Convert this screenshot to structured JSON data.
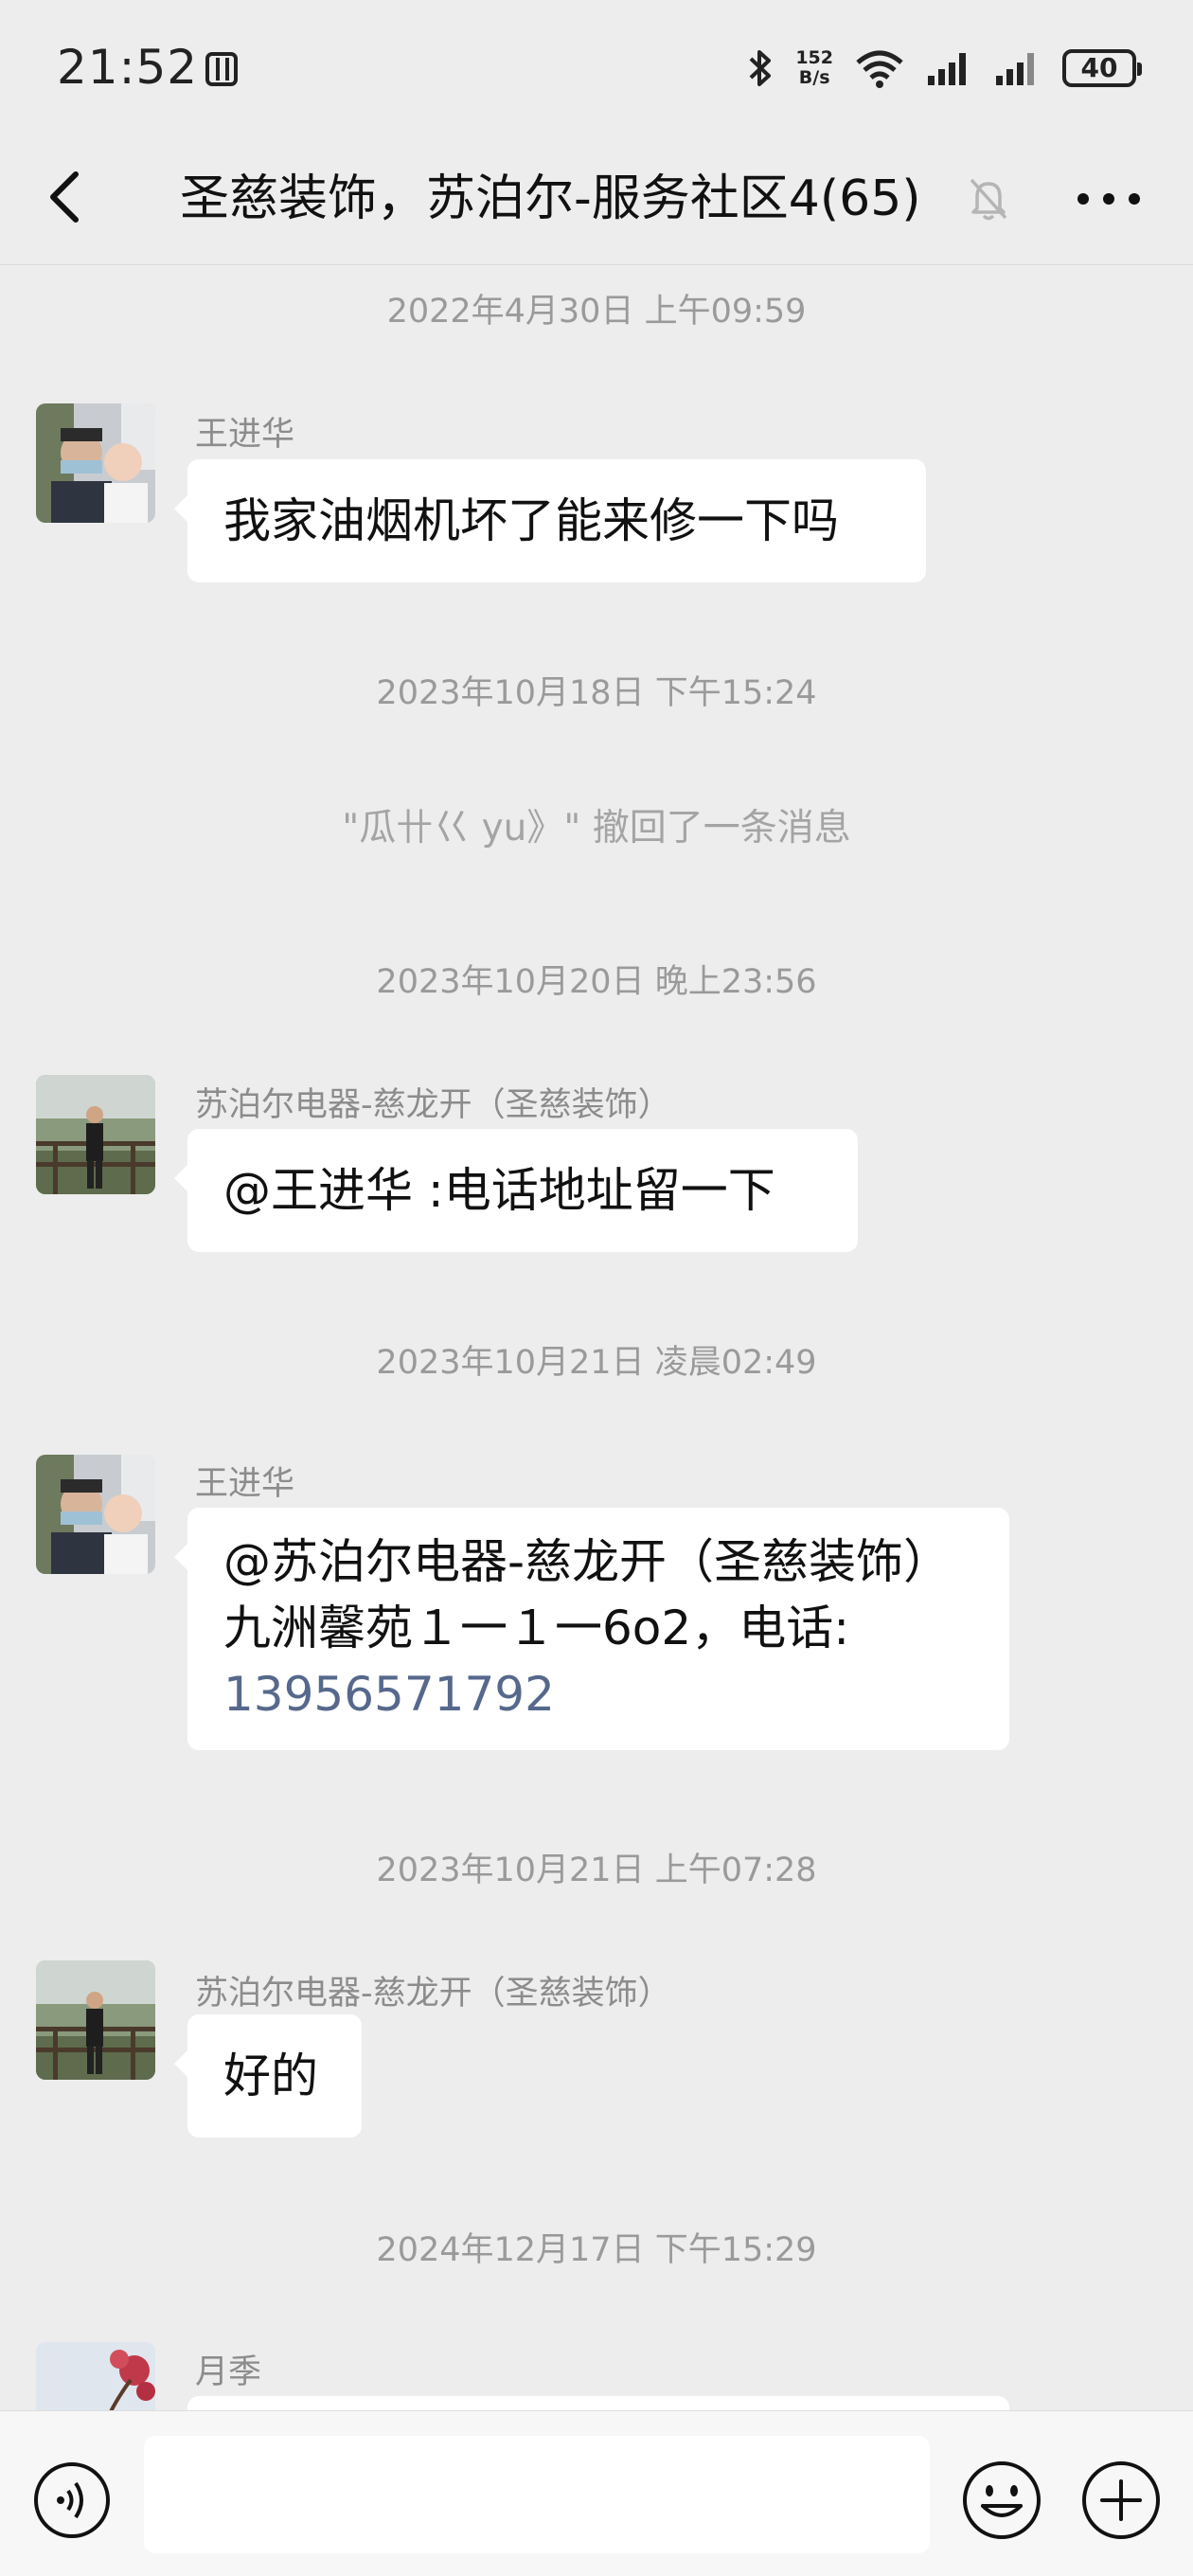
{
  "status_bar": {
    "time": "21:52",
    "net_speed_value": "152",
    "net_speed_unit": "B/s",
    "battery": "40"
  },
  "header": {
    "title": "圣慈装饰，苏泊尔-服务社区4(65)"
  },
  "messages": [
    {
      "type": "time",
      "text": "2022年4月30日 上午09:59"
    },
    {
      "type": "msg",
      "sender": "王进华",
      "lines": [
        "我家油烟机坏了能来修一下吗"
      ]
    },
    {
      "type": "time",
      "text": "2023年10月18日 下午15:24"
    },
    {
      "type": "recall",
      "text": "\"瓜卄巜 yu》\" 撤回了一条消息"
    },
    {
      "type": "time",
      "text": "2023年10月20日 晚上23:56"
    },
    {
      "type": "msg",
      "sender": "苏泊尔电器-慈龙开（圣慈装饰）",
      "lines": [
        "@王进华 :电话地址留一下"
      ]
    },
    {
      "type": "time",
      "text": "2023年10月21日 凌晨02:49"
    },
    {
      "type": "msg",
      "sender": "王进华",
      "lines": [
        "@苏泊尔电器-慈龙开（圣慈装饰）",
        " 九洲馨苑１一１一6o2，电话:"
      ],
      "phone": "13956571792"
    },
    {
      "type": "time",
      "text": "2023年10月21日 上午07:28"
    },
    {
      "type": "msg",
      "sender": "苏泊尔电器-慈龙开（圣慈装饰）",
      "lines": [
        "好的"
      ]
    },
    {
      "type": "time",
      "text": "2024年12月17日 下午15:29"
    },
    {
      "type": "msg",
      "sender": "月季",
      "lines": [
        ""
      ]
    }
  ],
  "input": {
    "value": "",
    "placeholder": ""
  },
  "icons": {
    "back": "chevron-left-icon",
    "mute": "bell-off-icon",
    "more": "more-dots-icon",
    "voice": "voice-icon",
    "emoji": "emoji-icon",
    "plus": "plus-icon"
  },
  "colors": {
    "background": "#ededed",
    "bubble": "#ffffff",
    "phone_link": "#56688c",
    "timestamp": "#9a9a9a"
  }
}
